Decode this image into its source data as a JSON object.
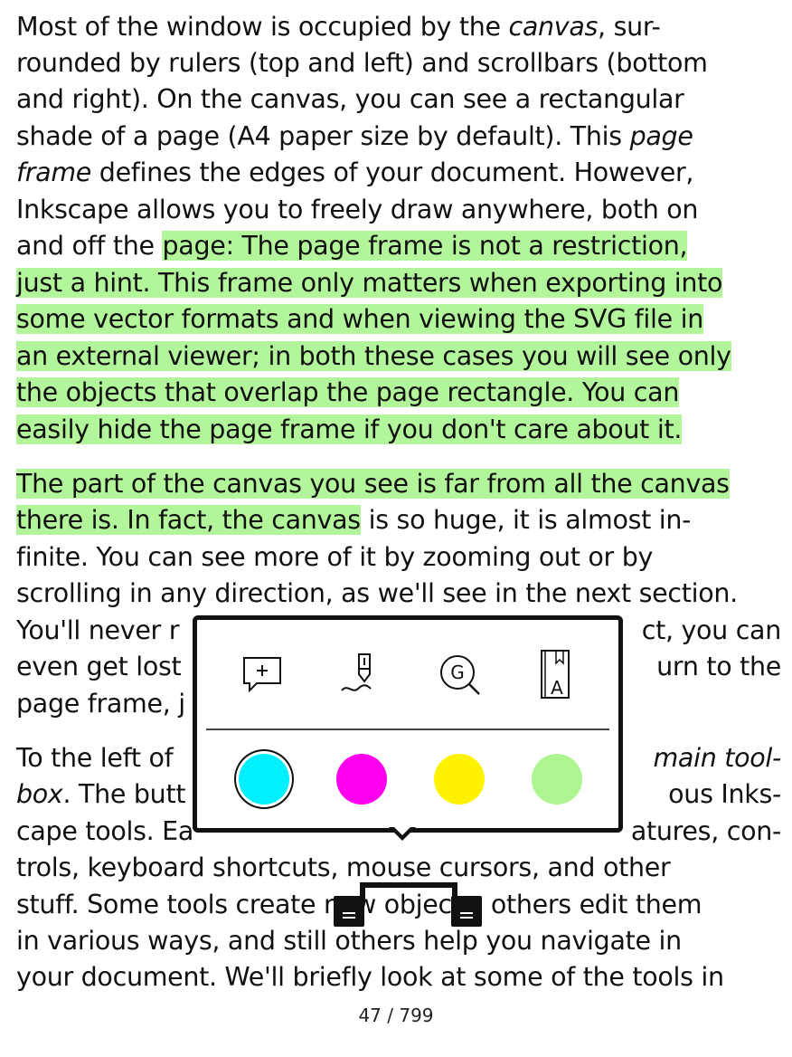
{
  "reader": {
    "lines": [
      {
        "segments": [
          {
            "t": "Most of the window is occupied by the "
          },
          {
            "t": "canvas",
            "em": true
          },
          {
            "t": ", sur-"
          }
        ]
      },
      {
        "segments": [
          {
            "t": "rounded by rulers (top and left) and scrollbars (bottom"
          }
        ]
      },
      {
        "segments": [
          {
            "t": "and right). On the canvas, you can see a rectangular"
          }
        ]
      },
      {
        "segments": [
          {
            "t": "shade of a page (A4 paper size by default). This "
          },
          {
            "t": "page",
            "em": true
          }
        ]
      },
      {
        "segments": [
          {
            "t": "frame",
            "em": true
          },
          {
            "t": " defines the edges of your document. However,"
          }
        ]
      },
      {
        "segments": [
          {
            "t": "Inkscape allows you to freely draw anywhere, both on"
          }
        ]
      },
      {
        "segments": [
          {
            "t": "and off the "
          },
          {
            "t": "page: The page frame is not a restriction,",
            "hl": true
          }
        ]
      },
      {
        "segments": [
          {
            "t": "just a hint. This frame only matters when exporting into",
            "hl": true
          }
        ]
      },
      {
        "segments": [
          {
            "t": "some vector formats and when viewing the SVG file in",
            "hl": true
          }
        ]
      },
      {
        "segments": [
          {
            "t": "an external viewer; in both these cases you will see only",
            "hl": true
          }
        ]
      },
      {
        "segments": [
          {
            "t": "the objects that overlap the page rectangle. You can",
            "hl": true
          }
        ]
      },
      {
        "segments": [
          {
            "t": "easily hide the page frame if you don't care about it.",
            "hl": true
          }
        ]
      },
      {
        "segments": [
          {
            "t": "The part of the canvas you see is far from all the canvas",
            "hl": true
          }
        ]
      },
      {
        "segments": [
          {
            "t": "there is. In fact, the canvas",
            "hl": true
          },
          {
            "t": " is so huge, it is almost in-"
          }
        ]
      },
      {
        "segments": [
          {
            "t": "finite. You can see more of it by zooming out or by"
          }
        ]
      },
      {
        "segments": [
          {
            "t": "scrolling in any direction, as we'll see in the next section."
          }
        ]
      },
      {
        "segments": [
          {
            "t": "You'll never r"
          }
        ],
        "right": [
          {
            "t": "ct, you can"
          }
        ]
      },
      {
        "segments": [
          {
            "t": "even get lost"
          }
        ],
        "right": [
          {
            "t": "urn to the"
          }
        ]
      },
      {
        "segments": [
          {
            "t": "page frame, j"
          }
        ]
      },
      {
        "segments": [
          {
            "t": "To the left of"
          }
        ],
        "right": [
          {
            "t": "main tool-",
            "em": true
          }
        ]
      },
      {
        "segments": [
          {
            "t": "box",
            "em": true
          },
          {
            "t": ". The butt"
          }
        ],
        "right": [
          {
            "t": "ous Inks-"
          }
        ]
      },
      {
        "segments": [
          {
            "t": "cape tools. Ea"
          }
        ],
        "right": [
          {
            "t": "atures, con-"
          }
        ]
      },
      {
        "segments": [
          {
            "t": "trols, keyboard shortcuts, mouse cursors, and other"
          }
        ]
      },
      {
        "segments": [
          {
            "t": "stuff. Some tools create new objects, others edit them"
          }
        ]
      },
      {
        "segments": [
          {
            "t": "in various ways, and still others help you navigate in"
          }
        ]
      },
      {
        "segments": [
          {
            "t": "your document. We'll briefly look at some of the tools in"
          }
        ]
      }
    ],
    "page_indicator": "47 / 799"
  },
  "popup": {
    "tools": [
      {
        "name": "add-note-icon",
        "glyph": "+"
      },
      {
        "name": "highlighter-pen-icon",
        "glyph": ""
      },
      {
        "name": "google-search-icon",
        "glyph": "G"
      },
      {
        "name": "dictionary-icon",
        "glyph": "A"
      }
    ],
    "colors": [
      {
        "name": "cyan",
        "hex": "#00f0ff",
        "selected": true
      },
      {
        "name": "magenta",
        "hex": "#ff00ee",
        "selected": false
      },
      {
        "name": "yellow",
        "hex": "#fff200",
        "selected": false
      },
      {
        "name": "light-green",
        "hex": "#adf58f",
        "selected": false
      }
    ]
  }
}
